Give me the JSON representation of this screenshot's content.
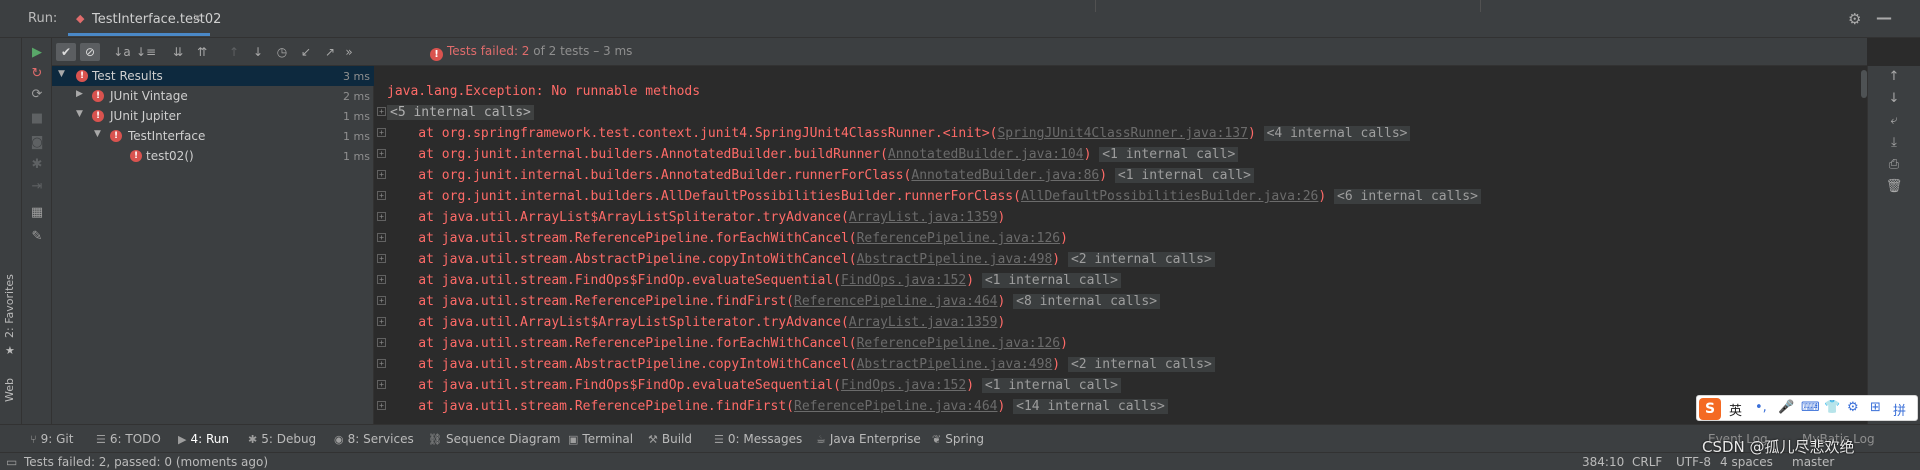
{
  "run_bar": {
    "label": "Run:",
    "tab_label": "TestInterface.test02",
    "close_glyph": "×",
    "gear_icon": "⚙",
    "minimize_icon": "—"
  },
  "left_stripe": {
    "favorites_label": "2: Favorites",
    "web_label": "Web"
  },
  "action_column": {
    "rerun_icon": "▶",
    "rerun_failed_icon": "↻",
    "toggle_icon": "⟳",
    "stop_icon": "■",
    "camera_icon": "◙",
    "debug_icon": "✱",
    "export_icon": "⇥",
    "layout_icon": "▦",
    "pin_icon": "✎"
  },
  "toolbar": {
    "icons": {
      "show_passed": "✔",
      "show_ignored": "⊘",
      "sort_alpha": "↓a",
      "sort_duration": "↓≡",
      "expand_all": "⇊",
      "collapse_all": "⇈",
      "prev_failed": "↑",
      "next_failed": "↓",
      "history": "◷",
      "import": "↙",
      "export": "↗",
      "more": "»"
    },
    "status": {
      "fail_icon": "!",
      "failed_label": "Tests failed: 2",
      "of_text": " of 2 tests",
      "duration_text": " – 3 ms"
    }
  },
  "tree": {
    "rows": [
      {
        "label": "Test Results",
        "time": "3 ms",
        "status_glyph": "!"
      },
      {
        "label": "JUnit Vintage",
        "time": "2 ms",
        "status_glyph": "!"
      },
      {
        "label": "JUnit Jupiter",
        "time": "1 ms",
        "status_glyph": "!"
      },
      {
        "label": "TestInterface",
        "time": "1 ms",
        "status_glyph": "!"
      },
      {
        "label": "test02()",
        "time": "1 ms",
        "status_glyph": "!"
      }
    ],
    "arrow_expanded": "▼",
    "arrow_collapsed": "▶"
  },
  "console": {
    "fold_glyph": "+",
    "lines": [
      {
        "indent": "",
        "text": "",
        "link": "",
        "after": "",
        "chip": ""
      },
      {
        "indent": "",
        "text": "java.lang.Exception: No runnable methods",
        "link": "",
        "after": "",
        "chip": ""
      },
      {
        "indent": "",
        "text": "",
        "link": "",
        "after": "",
        "chip": "<5 internal calls>"
      },
      {
        "indent": "    ",
        "text": "at org.springframework.test.context.junit4.SpringJUnit4ClassRunner.<init>(",
        "link": "SpringJUnit4ClassRunner.java:137",
        "after": ") ",
        "chip": "<4 internal calls>"
      },
      {
        "indent": "    ",
        "text": "at org.junit.internal.builders.AnnotatedBuilder.buildRunner(",
        "link": "AnnotatedBuilder.java:104",
        "after": ") ",
        "chip": "<1 internal call>"
      },
      {
        "indent": "    ",
        "text": "at org.junit.internal.builders.AnnotatedBuilder.runnerForClass(",
        "link": "AnnotatedBuilder.java:86",
        "after": ") ",
        "chip": "<1 internal call>"
      },
      {
        "indent": "    ",
        "text": "at org.junit.internal.builders.AllDefaultPossibilitiesBuilder.runnerForClass(",
        "link": "AllDefaultPossibilitiesBuilder.java:26",
        "after": ") ",
        "chip": "<6 internal calls>"
      },
      {
        "indent": "    ",
        "text": "at java.util.ArrayList$ArrayListSpliterator.tryAdvance(",
        "link": "ArrayList.java:1359",
        "after": ")",
        "chip": ""
      },
      {
        "indent": "    ",
        "text": "at java.util.stream.ReferencePipeline.forEachWithCancel(",
        "link": "ReferencePipeline.java:126",
        "after": ")",
        "chip": ""
      },
      {
        "indent": "    ",
        "text": "at java.util.stream.AbstractPipeline.copyIntoWithCancel(",
        "link": "AbstractPipeline.java:498",
        "after": ") ",
        "chip": "<2 internal calls>"
      },
      {
        "indent": "    ",
        "text": "at java.util.stream.FindOps$FindOp.evaluateSequential(",
        "link": "FindOps.java:152",
        "after": ") ",
        "chip": "<1 internal call>"
      },
      {
        "indent": "    ",
        "text": "at java.util.stream.ReferencePipeline.findFirst(",
        "link": "ReferencePipeline.java:464",
        "after": ") ",
        "chip": "<8 internal calls>"
      },
      {
        "indent": "    ",
        "text": "at java.util.ArrayList$ArrayListSpliterator.tryAdvance(",
        "link": "ArrayList.java:1359",
        "after": ")",
        "chip": ""
      },
      {
        "indent": "    ",
        "text": "at java.util.stream.ReferencePipeline.forEachWithCancel(",
        "link": "ReferencePipeline.java:126",
        "after": ")",
        "chip": ""
      },
      {
        "indent": "    ",
        "text": "at java.util.stream.AbstractPipeline.copyIntoWithCancel(",
        "link": "AbstractPipeline.java:498",
        "after": ") ",
        "chip": "<2 internal calls>"
      },
      {
        "indent": "    ",
        "text": "at java.util.stream.FindOps$FindOp.evaluateSequential(",
        "link": "FindOps.java:152",
        "after": ") ",
        "chip": "<1 internal call>"
      },
      {
        "indent": "    ",
        "text": "at java.util.stream.ReferencePipeline.findFirst(",
        "link": "ReferencePipeline.java:464",
        "after": ") ",
        "chip": "<14 internal calls>"
      }
    ]
  },
  "right_bar": {
    "up_icon": "↑",
    "down_icon": "↓",
    "wrap_icon": "⤶",
    "scroll_end_icon": "⤓",
    "print_icon": "⎙",
    "trash_icon": "🗑"
  },
  "tool_tabs": [
    {
      "icon": "⑂",
      "label": "9: Git"
    },
    {
      "icon": "☰",
      "label": "6: TODO"
    },
    {
      "icon": "▶",
      "label": "4: Run"
    },
    {
      "icon": "✱",
      "label": "5: Debug"
    },
    {
      "icon": "◉",
      "label": "8: Services"
    },
    {
      "icon": "⛓",
      "label": "Sequence Diagram"
    },
    {
      "icon": "▣",
      "label": "Terminal"
    },
    {
      "icon": "⚒",
      "label": "Build"
    },
    {
      "icon": "☰",
      "label": "0: Messages"
    },
    {
      "icon": "☕",
      "label": "Java Enterprise"
    },
    {
      "icon": "❦",
      "label": "Spring"
    }
  ],
  "tool_tabs_right": {
    "event_log": "Event Log",
    "mybatis_log": "MyBatis Log"
  },
  "status_bar": {
    "message": "Tests failed: 2, passed: 0 (moments ago)",
    "position": "384:10",
    "line_sep": "CRLF",
    "encoding": "UTF-8",
    "indent": "4 spaces",
    "branch": "master"
  },
  "ime": {
    "logo": "S",
    "lang": "英",
    "items": [
      "•,",
      "🎤",
      "⌨",
      "👕",
      "⚙",
      "⊞",
      "拼"
    ]
  },
  "watermark": "CSDN @孤儿尽悲欢绝",
  "colors": {
    "error_text": "#ff6b68",
    "accent": "#4a88c7",
    "fail_badge": "#d9534f",
    "panel_bg": "#3c3f41",
    "console_bg": "#2b2b2b"
  }
}
